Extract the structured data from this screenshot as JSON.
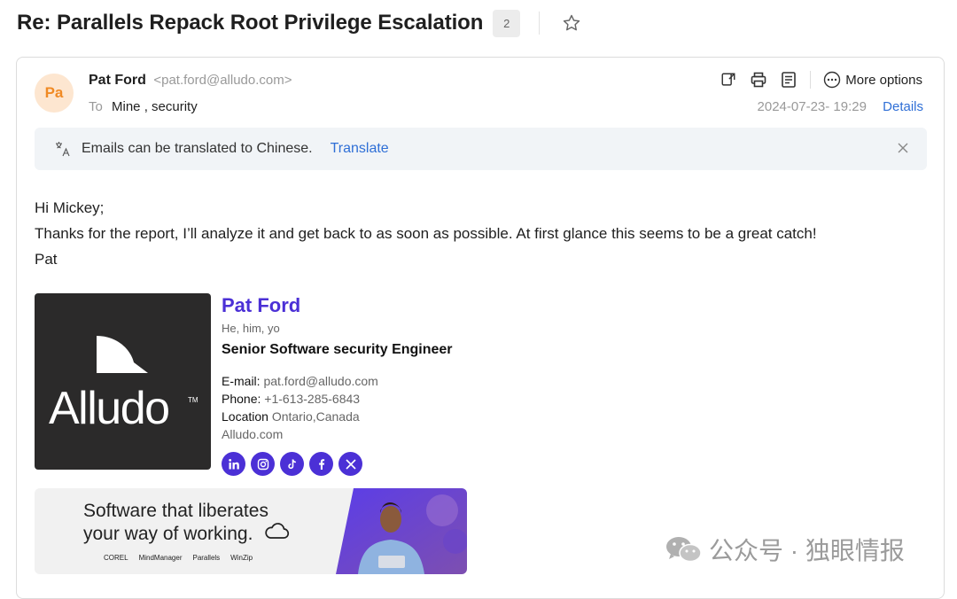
{
  "subject": {
    "title": "Re: Parallels Repack Root Privilege Escalation",
    "thread_count": "2"
  },
  "message": {
    "avatar_initials": "Pa",
    "sender_name": "Pat Ford",
    "sender_email": "<pat.ford@alludo.com>",
    "to_label": "To",
    "to_recipients": "Mine , security",
    "datetime": "2024-07-23- 19:29",
    "details_label": "Details",
    "more_options_label": "More options"
  },
  "translate_bar": {
    "message": "Emails can be translated to Chinese.",
    "action_label": "Translate"
  },
  "body_lines": [
    "Hi Mickey;",
    "Thanks for the report, I’ll analyze it and get back to as soon as possible. At first glance this seems to be a great catch!",
    "Pat"
  ],
  "signature": {
    "logo_text": "Alludo",
    "logo_tm": "TM",
    "name": "Pat Ford",
    "pronouns": "He, him, yo",
    "title": "Senior Software security Engineer",
    "email_label": "E-mail:",
    "email": "pat.ford@alludo.com",
    "phone_label": "Phone:",
    "phone": "+1-613-285-6843",
    "location_label": "Location",
    "location": "Ontario,Canada",
    "website": "Alludo.com",
    "socials": [
      "linkedin-icon",
      "instagram-icon",
      "tiktok-icon",
      "facebook-icon",
      "x-icon"
    ]
  },
  "banner": {
    "line1": "Software that liberates",
    "line2": "your way of working.",
    "brands": [
      "COREL",
      "MindManager",
      "Parallels",
      "WinZip"
    ]
  },
  "watermark": {
    "text": "公众号 · 独眼情报"
  },
  "colors": {
    "accent_purple": "#4b30d6",
    "link_blue": "#2f6fd6",
    "avatar_bg": "#fde6d0",
    "avatar_fg": "#f08a24"
  }
}
